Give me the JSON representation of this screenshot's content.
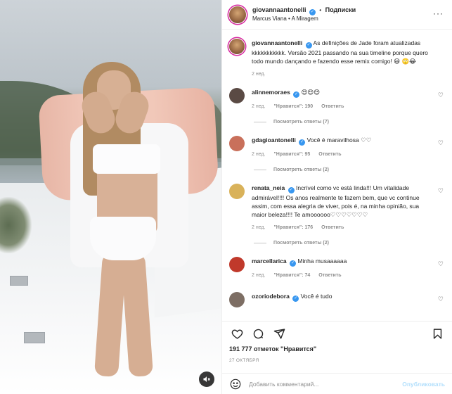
{
  "header": {
    "username": "giovannaantonelli",
    "dot": "•",
    "follow_label": "Подписки",
    "audio": "Marcus Viana • A Miragem",
    "more_glyph": "···"
  },
  "caption": {
    "username": "giovannaantonelli",
    "text": "As definições de Jade foram atualizadas kkkkkkkkkkk. Versão 2021 passando na sua timeline porque quero todo mundo dançando e fazendo esse remix comigo! 😄 🙄😂",
    "time": "2 нед."
  },
  "comments": [
    {
      "username": "alinnemoraes",
      "text": "😍😍😍",
      "time": "2 нед.",
      "likes": "\"Нравится\": 190",
      "reply": "Ответить",
      "replies": "Посмотреть ответы (7)",
      "avatar_color": "#5a4a44"
    },
    {
      "username": "gdagioantonelli",
      "text": "Você é maravilhosa ♡♡",
      "time": "2 нед.",
      "likes": "\"Нравится\": 95",
      "reply": "Ответить",
      "replies": "Посмотреть ответы (2)",
      "avatar_color": "#c9705b"
    },
    {
      "username": "renata_neia",
      "text": "Incrível como vc está linda!!! Um vitalidade admirável!!!! Os anos realmente te fazem bem, que vc continue assim, com essa alegria de viver, pois é, na minha opinião, sua maior beleza!!!! Te amoooooo♡♡♡♡♡♡♡",
      "time": "2 нед.",
      "likes": "\"Нравится\": 176",
      "reply": "Ответить",
      "replies": "Посмотреть ответы (2)",
      "avatar_color": "#d9b25a"
    },
    {
      "username": "marcellarica",
      "text": "Minha musaaaaaa",
      "time": "2 нед.",
      "likes": "\"Нравится\": 74",
      "reply": "Ответить",
      "replies": "",
      "avatar_color": "#c0392b"
    },
    {
      "username": "ozoriodebora",
      "text": "Você é tudo",
      "time": "",
      "likes": "",
      "reply": "",
      "replies": "",
      "avatar_color": "#7d6e64"
    }
  ],
  "likes": "191 777 отметок \"Нравится\"",
  "date": "27 ОКТЯБРЯ",
  "composer": {
    "placeholder": "Добавить комментарий...",
    "publish_label": "Опубликовать"
  },
  "icons": {
    "like": "heart-icon",
    "comment": "comment-icon",
    "share": "share-icon",
    "save": "bookmark-icon",
    "emoji": "emoji-icon",
    "sound": "speaker-muted-icon",
    "verified": "verified-badge-icon"
  },
  "colors": {
    "verified": "#3897f0",
    "publish_disabled": "#b2dffc",
    "meta_gray": "#8e8e8e"
  }
}
